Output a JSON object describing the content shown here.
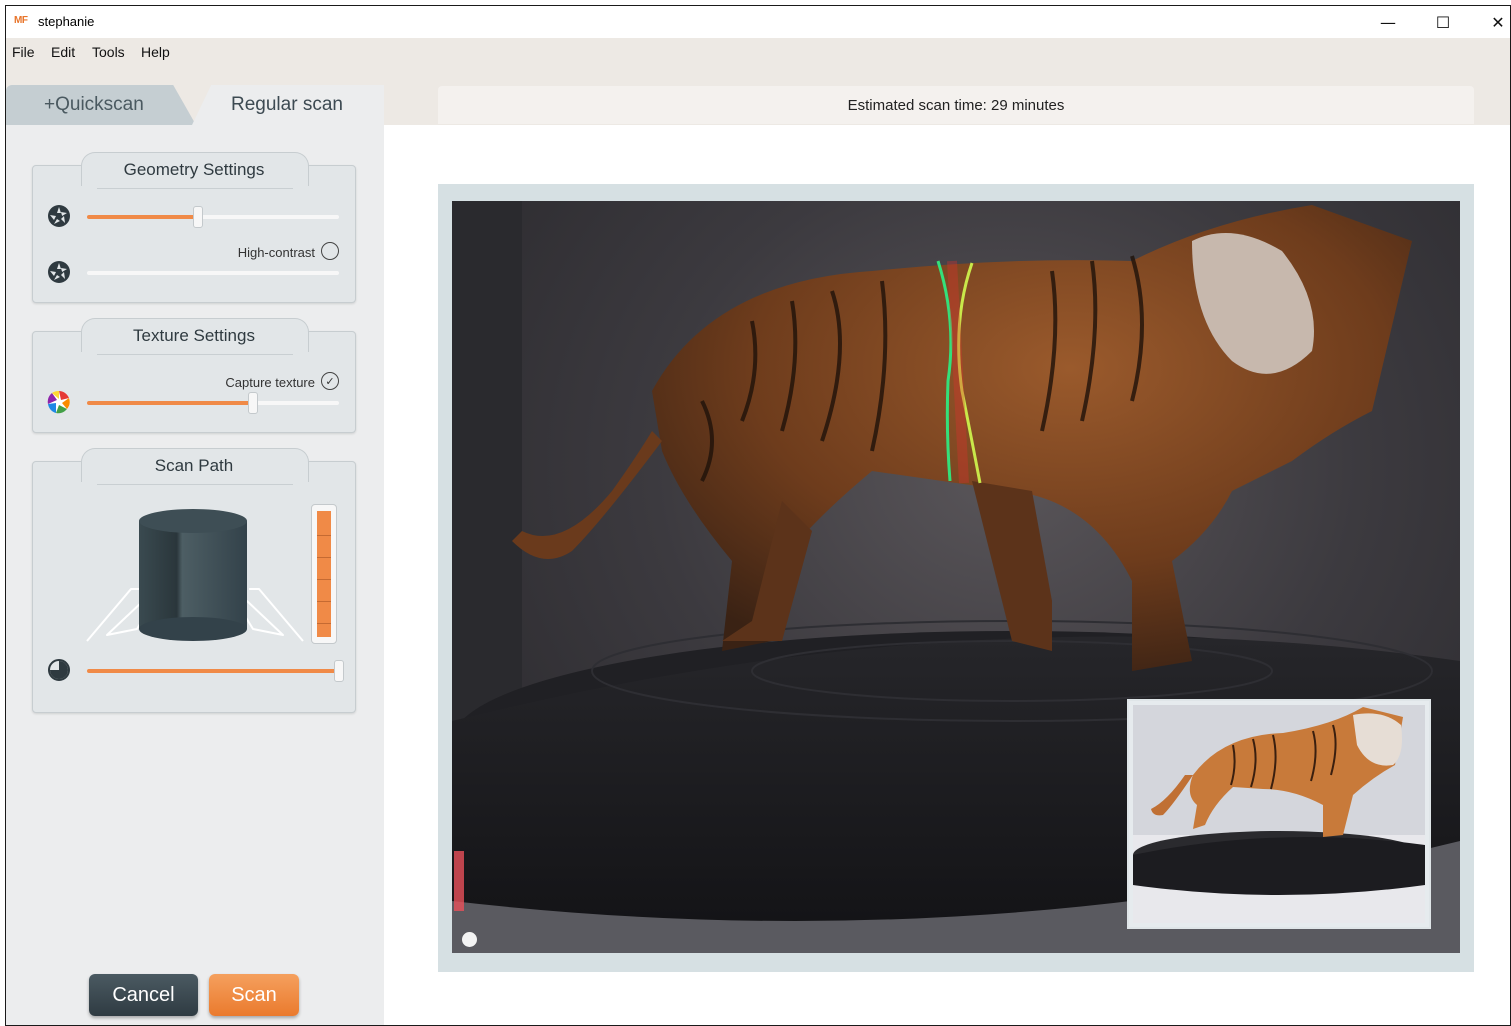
{
  "window": {
    "logo": "MF",
    "title": "stephanie",
    "minimize": "—",
    "maximize": "☐",
    "close": "✕"
  },
  "menu": {
    "items": [
      "File",
      "Edit",
      "Tools",
      "Help"
    ]
  },
  "tabs": {
    "quickscan": "+Quickscan",
    "regular": "Regular scan",
    "active": "Regular scan"
  },
  "estimate": {
    "text": "Estimated scan time: 29 minutes"
  },
  "geometry": {
    "title": "Geometry Settings",
    "slider1_value": 0.44,
    "high_contrast_label": "High-contrast",
    "high_contrast_checked": false,
    "slider2_value": 0.0
  },
  "texture": {
    "title": "Texture Settings",
    "capture_label": "Capture texture",
    "capture_checked": true,
    "slider_value": 0.66
  },
  "scan_path": {
    "title": "Scan Path",
    "vertical_value": 1.0,
    "rotation_value": 1.0
  },
  "buttons": {
    "cancel": "Cancel",
    "scan": "Scan"
  },
  "colors": {
    "accent": "#f08a47",
    "dark_button": "#3b4850",
    "panel": "#e2e6e8"
  }
}
